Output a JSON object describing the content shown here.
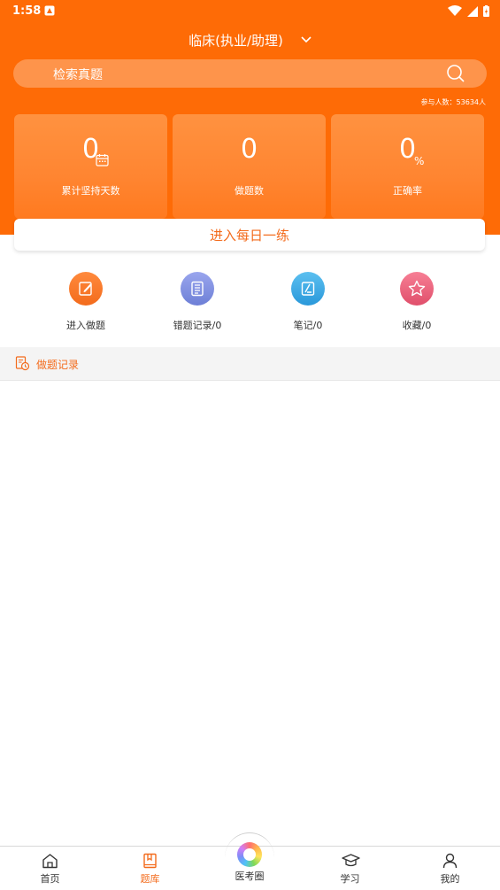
{
  "status_bar": {
    "time": "1:58"
  },
  "header": {
    "title": "临床(执业/助理)",
    "search_placeholder": "检索真题",
    "participants": "参与人数：53634人"
  },
  "stats": [
    {
      "value": "0",
      "label": "累计坚持天数",
      "icon": "calendar-icon"
    },
    {
      "value": "0",
      "label": "做题数"
    },
    {
      "value": "0",
      "unit": "%",
      "label": "正确率"
    }
  ],
  "daily_practice_label": "进入每日一练",
  "quick_actions": [
    {
      "label": "进入做题",
      "icon": "edit-icon",
      "color": "#f9742a"
    },
    {
      "label": "错题记录/0",
      "icon": "notebook-icon",
      "color": "#7b8de0"
    },
    {
      "label": "笔记/0",
      "icon": "note-icon",
      "color": "#35a8e6"
    },
    {
      "label": "收藏/0",
      "icon": "star-icon",
      "color": "#ec5f7a"
    }
  ],
  "record_section": {
    "label": "做题记录"
  },
  "tab_bar": {
    "tabs": [
      {
        "label": "首页",
        "icon": "home-icon"
      },
      {
        "label": "题库",
        "icon": "book-icon",
        "active": true
      },
      {
        "label": "医考圈",
        "icon": "circle-logo-icon"
      },
      {
        "label": "学习",
        "icon": "graduation-cap-icon"
      },
      {
        "label": "我的",
        "icon": "user-icon"
      }
    ]
  },
  "colors": {
    "brand": "#fe6b06",
    "accent_text": "#f36b1c"
  }
}
